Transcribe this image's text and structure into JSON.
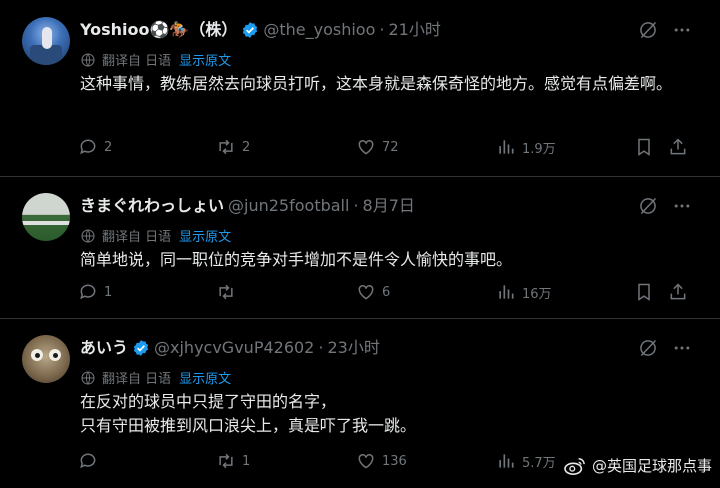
{
  "posts": [
    {
      "name": "Yoshioo⚽🏇（株）",
      "handle": "@the_yoshioo",
      "time": "21小时",
      "translated_from": "翻译自 日语",
      "show_original": "显示原文",
      "text": "这种事情，教练居然去向球员打听，这本身就是森保奇怪的地方。感觉有点偏差啊。",
      "replies": "2",
      "reposts": "2",
      "likes": "72",
      "views": "1.9万"
    },
    {
      "name": "きまぐれわっしょい",
      "handle": "@jun25football",
      "time": "8月7日",
      "translated_from": "翻译自 日语",
      "show_original": "显示原文",
      "text": "简单地说，同一职位的竞争对手增加不是件令人愉快的事吧。",
      "replies": "1",
      "reposts": "",
      "likes": "6",
      "views": "16万"
    },
    {
      "name": "あいう",
      "handle": "@xjhycvGvuP42602",
      "time": "23小时",
      "translated_from": "翻译自 日语",
      "show_original": "显示原文",
      "text": "在反对的球员中只提了守田的名字，\n只有守田被推到风口浪尖上，真是吓了我一跳。",
      "replies": "",
      "reposts": "1",
      "likes": "136",
      "views": "5.7万"
    }
  ],
  "watermark": "@英国足球那点事",
  "colors": {
    "background": "#000000",
    "text": "#e7e9ea",
    "muted": "#71767b",
    "accent": "#1d9bf0",
    "divider": "#2f3336"
  },
  "icons": [
    "verified-badge-icon",
    "translate-icon",
    "grok-icon",
    "more-icon",
    "reply-icon",
    "repost-icon",
    "like-icon",
    "views-icon",
    "bookmark-icon",
    "share-icon",
    "weibo-icon"
  ]
}
